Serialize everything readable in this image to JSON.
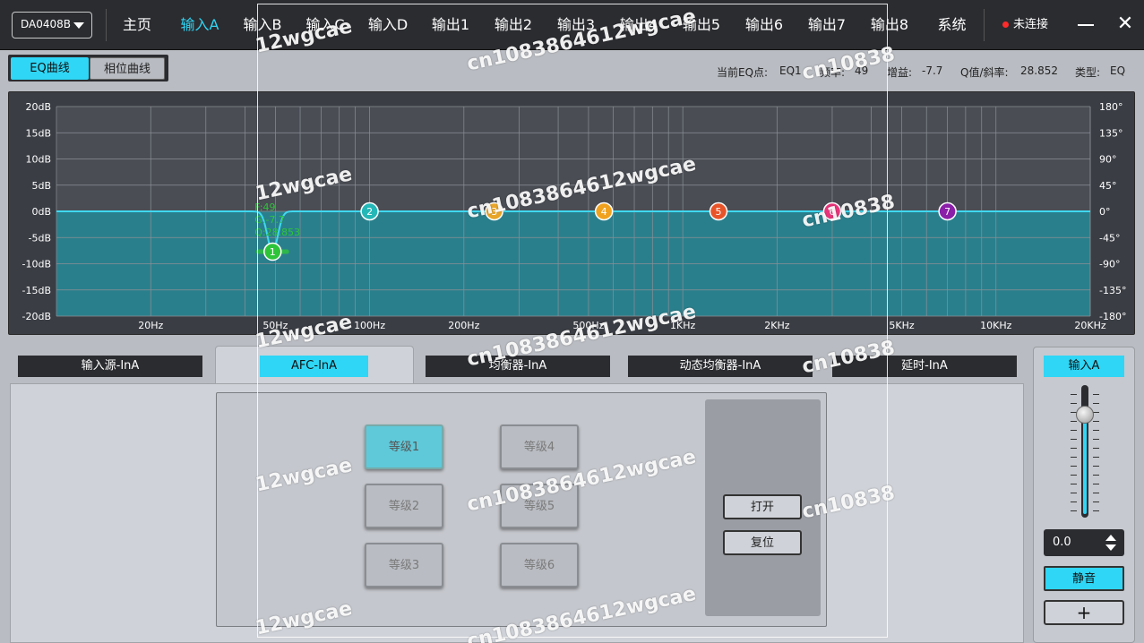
{
  "topbar": {
    "device": "DA0408B",
    "nav": [
      "主页",
      "输入A",
      "输入B",
      "输入C",
      "输入D",
      "输出1",
      "输出2",
      "输出3",
      "输出4",
      "输出5",
      "输出6",
      "输出7",
      "输出8",
      "系统"
    ],
    "active_nav": "输入A",
    "connection": "未连接",
    "close_glyph": "✕"
  },
  "curve_tabs": {
    "eq": "EQ曲线",
    "phase": "相位曲线",
    "active": "EQ曲线"
  },
  "eq_info": {
    "point_label": "当前EQ点:",
    "point": "EQ1",
    "freq_label": "频率:",
    "freq": "49",
    "gain_label": "增益:",
    "gain": "-7.7",
    "q_label": "Q值/斜率:",
    "q": "28.852",
    "type_label": "类型:",
    "type": "EQ"
  },
  "chart_data": {
    "type": "line",
    "x_scale": "log",
    "xlim": [
      10,
      20000
    ],
    "ylim_left": [
      -20,
      20
    ],
    "ylim_right": [
      -180,
      180
    ],
    "x_ticks": [
      "20Hz",
      "50Hz",
      "100Hz",
      "200Hz",
      "500Hz",
      "1KHz",
      "2KHz",
      "5KHz",
      "10KHz",
      "20KHz"
    ],
    "x_tick_values": [
      20,
      50,
      100,
      200,
      500,
      1000,
      2000,
      5000,
      10000,
      20000
    ],
    "y_ticks_left": [
      "20dB",
      "15dB",
      "10dB",
      "5dB",
      "0dB",
      "-5dB",
      "-10dB",
      "-15dB",
      "-20dB"
    ],
    "y_ticks_right": [
      "180°",
      "135°",
      "90°",
      "45°",
      "0°",
      "-45°",
      "-90°",
      "-135°",
      "-180°"
    ],
    "grid": true,
    "eq_points": [
      {
        "label": "1",
        "freq": 49,
        "gain": -7.7,
        "color": "#2ec43a"
      },
      {
        "label": "2",
        "freq": 100,
        "gain": 0,
        "color": "#25b7b7"
      },
      {
        "label": "3",
        "freq": 250,
        "gain": 0,
        "color": "#e8a52a"
      },
      {
        "label": "4",
        "freq": 560,
        "gain": 0,
        "color": "#f0a21f"
      },
      {
        "label": "5",
        "freq": 1300,
        "gain": 0,
        "color": "#e8542a"
      },
      {
        "label": "6",
        "freq": 3000,
        "gain": 0,
        "color": "#e8347a"
      },
      {
        "label": "7",
        "freq": 7000,
        "gain": 0,
        "color": "#8a1fa8"
      }
    ],
    "point_annotation": [
      "F:49",
      "G:-7.7",
      "Q:28.853"
    ],
    "curve_color": "#3fd8f0",
    "fill_color": "#2a7f8c"
  },
  "sections": [
    "输入源-InA",
    "AFC-InA",
    "均衡器-InA",
    "动态均衡器-InA",
    "延时-InA"
  ],
  "active_section": "AFC-InA",
  "afc": {
    "levels": [
      "等级1",
      "等级2",
      "等级3",
      "等级4",
      "等级5",
      "等级6"
    ],
    "active_level": "等级1",
    "open": "打开",
    "reset": "复位"
  },
  "channel": {
    "label": "输入A",
    "gain": "0.0",
    "fader_level": 0.8,
    "mute": "静音",
    "add": "+"
  },
  "watermarks": [
    "12wgcae",
    "cn1083864612wgcae",
    "cn10838"
  ],
  "colors": {
    "accent": "#2fd6f5",
    "bar": "#2b2c30",
    "panel": "#cfd2d8"
  }
}
